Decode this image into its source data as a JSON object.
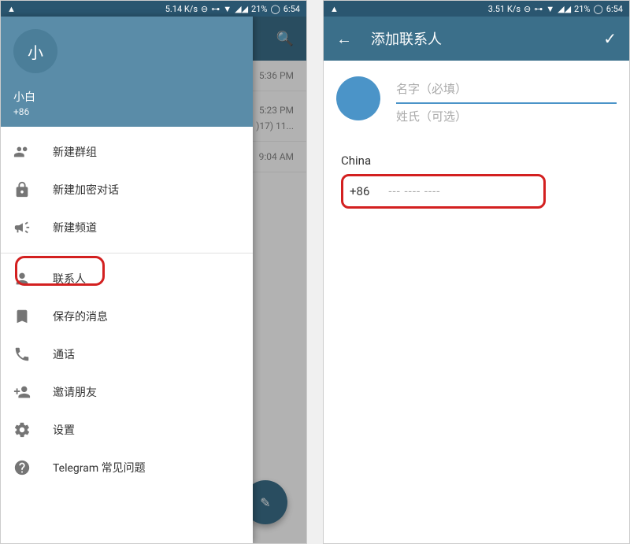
{
  "status": {
    "speed1": "5.14 K/s",
    "speed2": "3.51 K/s",
    "battery": "21%",
    "time": "6:54"
  },
  "drawer": {
    "avatar_text": "小",
    "username": "小白",
    "phone": "+86",
    "items": [
      {
        "label": "新建群组",
        "icon": "group-icon"
      },
      {
        "label": "新建加密对话",
        "icon": "lock-icon"
      },
      {
        "label": "新建频道",
        "icon": "megaphone-icon"
      },
      {
        "label": "联系人",
        "icon": "person-icon"
      },
      {
        "label": "保存的消息",
        "icon": "bookmark-icon"
      },
      {
        "label": "通话",
        "icon": "phone-icon"
      },
      {
        "label": "邀请朋友",
        "icon": "invite-icon"
      },
      {
        "label": "设置",
        "icon": "gear-icon"
      },
      {
        "label": "Telegram 常见问题",
        "icon": "help-icon"
      }
    ]
  },
  "chat_bg": {
    "times": [
      "5:36 PM",
      "5:23 PM",
      "9:04 AM"
    ],
    "snippet": ")17) 11..."
  },
  "add_contact": {
    "title": "添加联系人",
    "first_name_ph": "名字（必填）",
    "last_name_ph": "姓氏（可选）",
    "country": "China",
    "code": "+86",
    "phone_ph": "--- ---- ----"
  }
}
